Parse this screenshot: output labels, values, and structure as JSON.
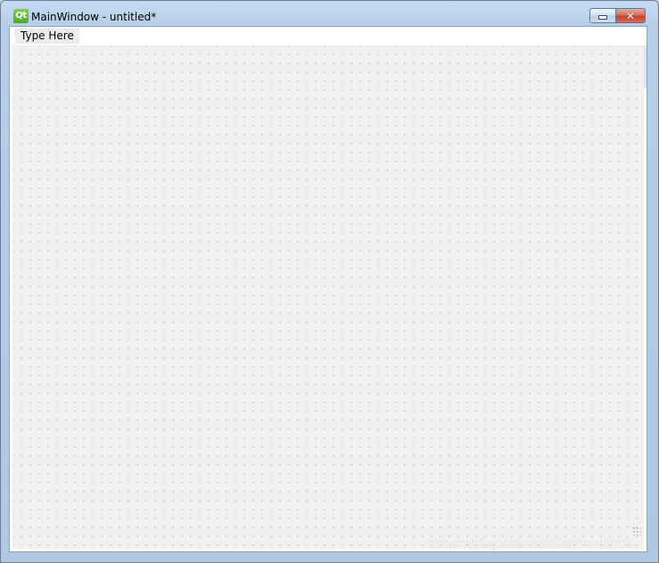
{
  "window": {
    "title": "MainWindow - untitled*",
    "app_icon": {
      "name": "qt-logo-icon",
      "label": "Qt",
      "color": "#41cd52"
    },
    "buttons": {
      "minimize_icon": "minimize-icon",
      "close_glyph": "✕",
      "close_color": "#c4452c"
    }
  },
  "menubar": {
    "items": [
      {
        "label": "Type Here"
      }
    ]
  },
  "design_area": {
    "grid": true,
    "background": "#f0f0f0"
  },
  "watermark": {
    "text": "https://blog.csdn.net/DaoYuanTech"
  }
}
